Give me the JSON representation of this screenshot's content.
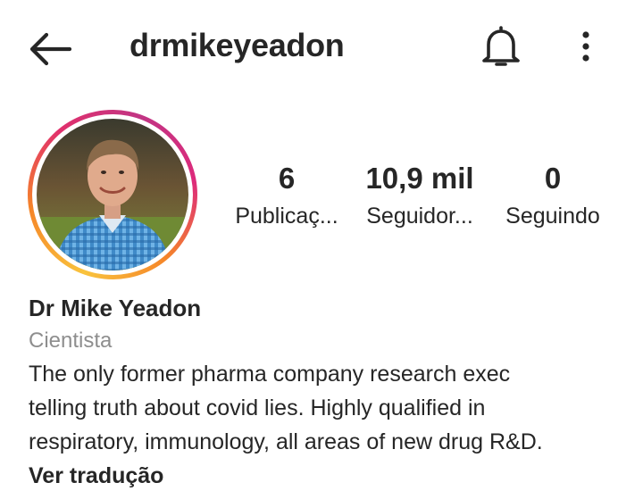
{
  "header": {
    "username": "drmikeyeadon",
    "back_icon": "back-arrow-icon",
    "notification_icon": "bell-icon",
    "more_icon": "more-vertical-icon"
  },
  "profile": {
    "avatar": "profile-photo",
    "ring_colors": [
      "#f9c33d",
      "#f58529",
      "#e1306c",
      "#c13584"
    ]
  },
  "stats": {
    "posts": {
      "value": "6",
      "label": "Publicaç..."
    },
    "followers": {
      "value": "10,9 mil",
      "label": "Seguidor..."
    },
    "following": {
      "value": "0",
      "label": "Seguindo"
    }
  },
  "bio": {
    "name": "Dr Mike Yeadon",
    "category": "Cientista",
    "lines": [
      "The only former pharma company research exec",
      "telling truth about covid lies. Highly qualified in",
      "respiratory, immunology, all areas of new drug R&D."
    ],
    "translate_label": "Ver tradução"
  }
}
